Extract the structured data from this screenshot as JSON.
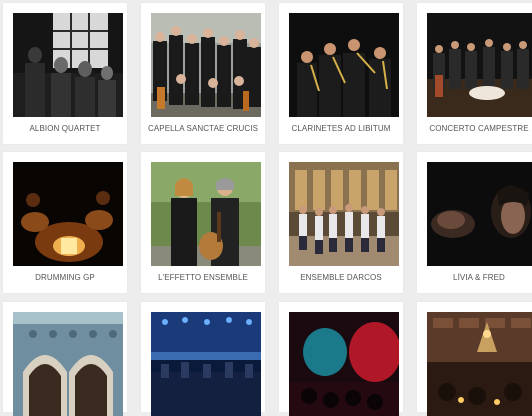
{
  "ensembles": [
    {
      "name": "ALBION QUARTET",
      "image": "four musicians with string instruments before a window, black and white"
    },
    {
      "name": "CAPELLA SANCTAE CRUCIS",
      "image": "group of musicians in dark clothes with instruments"
    },
    {
      "name": "CLARINETES AD LIBITUM",
      "image": "clarinet players on a dark stage"
    },
    {
      "name": "CONCERTO CAMPESTRE",
      "image": "orchestra performing on a stage"
    },
    {
      "name": "DRUMMING GP",
      "image": "percussionists under warm light in darkness"
    },
    {
      "name": "L'EFFETTO ENSEMBLE",
      "image": "woman and man holding a guitar outdoors"
    },
    {
      "name": "ENSEMBLE DARCOS",
      "image": "choir standing in a hall"
    },
    {
      "name": "LÍVIA & FRED",
      "image": "two faces in low light"
    },
    {
      "name": "",
      "image": "moorish tiled arches"
    },
    {
      "name": "",
      "image": "concert stage with blue lights"
    },
    {
      "name": "",
      "image": "concert with red and cyan stage lights"
    },
    {
      "name": "",
      "image": "musicians by candlelight in a stone room"
    }
  ]
}
